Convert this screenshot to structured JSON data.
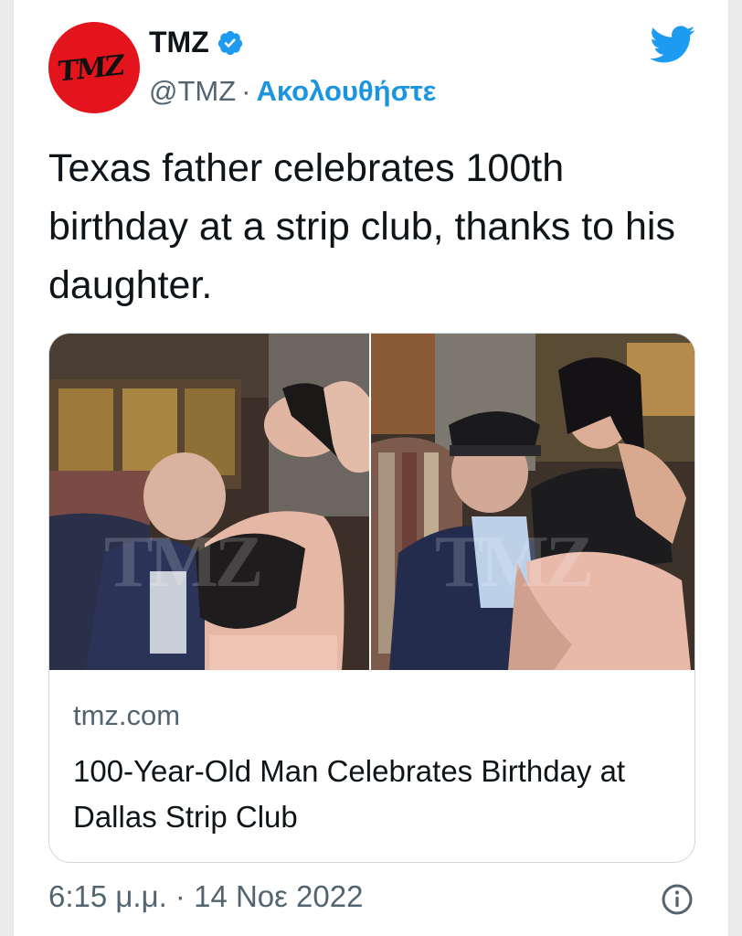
{
  "author": {
    "avatar_text": "TMZ",
    "display_name": "TMZ",
    "handle": "@TMZ",
    "separator": "·",
    "follow_label": "Ακολουθήστε",
    "verified_icon": "verified-badge-icon"
  },
  "brand_icon": "twitter-bird-icon",
  "tweet": {
    "text": "Texas father celebrates 100th birthday at a strip club, thanks to his daughter."
  },
  "card": {
    "watermark": "TMZ",
    "domain": "tmz.com",
    "title": "100-Year-Old Man Celebrates Birthday at Dallas Strip Club"
  },
  "footer": {
    "timestamp": "6:15 μ.μ. · 14 Νοε 2022",
    "info_icon": "info-icon"
  },
  "colors": {
    "accent": "#1b95e0",
    "text": "#0f1419",
    "secondary": "#536471",
    "brand_red": "#e3141b"
  }
}
